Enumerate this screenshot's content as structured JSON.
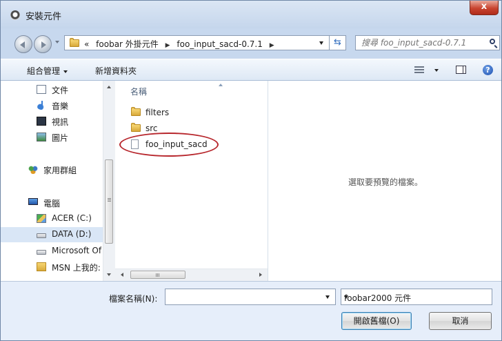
{
  "window": {
    "title": "安裝元件",
    "close_label": "x"
  },
  "navbar": {
    "breadcrumbs": [
      "«",
      "foobar 外掛元件",
      "foo_input_sacd-0.7.1"
    ],
    "search_placeholder": "搜尋 foo_input_sacd-0.7.1"
  },
  "toolbar": {
    "organize_label": "組合管理",
    "new_folder_label": "新增資料夾"
  },
  "sidebar": {
    "items": [
      {
        "label": "文件",
        "icon": "document-icon"
      },
      {
        "label": "音樂",
        "icon": "music-icon"
      },
      {
        "label": "視訊",
        "icon": "video-icon"
      },
      {
        "label": "圖片",
        "icon": "picture-icon"
      },
      {
        "label": "家用群組",
        "icon": "homegroup-icon"
      },
      {
        "label": "電腦",
        "icon": "computer-icon"
      },
      {
        "label": "ACER (C:)",
        "icon": "drive-icon"
      },
      {
        "label": "DATA (D:)",
        "icon": "drive-icon",
        "selected": true
      },
      {
        "label": "Microsoft Of",
        "icon": "drive-icon"
      },
      {
        "label": "MSN 上我的:",
        "icon": "folder-icon"
      }
    ]
  },
  "filelist": {
    "column_name": "名稱",
    "items": [
      {
        "name": "filters",
        "type": "folder"
      },
      {
        "name": "src",
        "type": "folder"
      },
      {
        "name": "foo_input_sacd",
        "type": "file",
        "circled": true
      }
    ],
    "hscroll_grip": "III"
  },
  "preview": {
    "message": "選取要預覽的檔案。"
  },
  "bottom": {
    "filename_label": "檔案名稱(N):",
    "filename_value": "",
    "filetype_value": "foobar2000 元件",
    "open_label": "開啟舊檔(O)",
    "cancel_label": "取消"
  },
  "colors": {
    "accent": "#3c7fb1",
    "highlight_circle": "#b7262c",
    "selection": "#d9e6f6"
  }
}
